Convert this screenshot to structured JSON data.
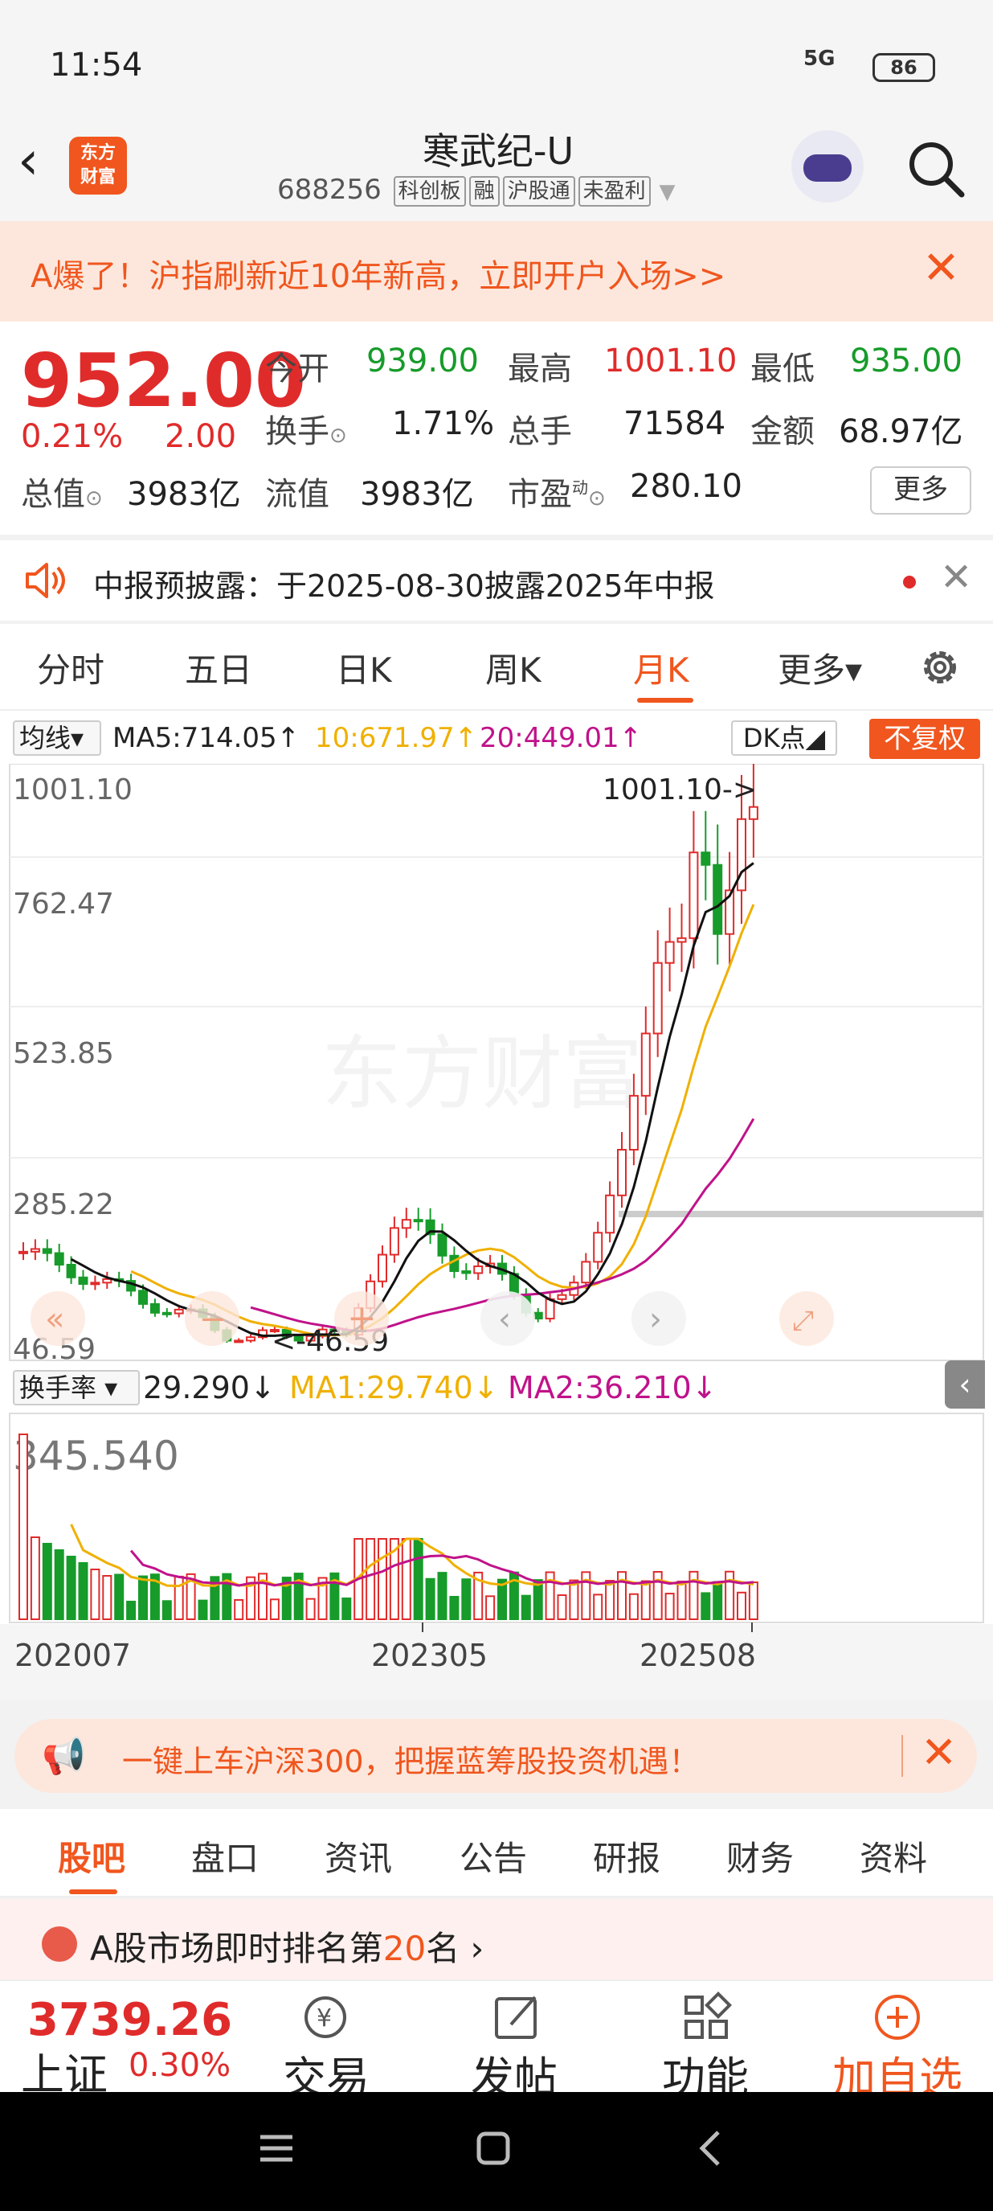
{
  "status": {
    "time": "11:54",
    "signal": "5G",
    "battery": "86"
  },
  "header": {
    "back_icon": "chevron-left-icon",
    "logo_line1": "东方",
    "logo_line2": "财富",
    "stock_name": "寒武纪-U",
    "stock_code": "688256",
    "tags": [
      "科创板",
      "融",
      "沪股通",
      "未盈利"
    ],
    "search_icon": "search-icon"
  },
  "promo": {
    "text": "A爆了！沪指刷新近10年新高，立即开户入场>>"
  },
  "quote": {
    "price": "952.00",
    "change_pct": "0.21%",
    "change_amt": "2.00",
    "open_label": "今开",
    "open": "939.00",
    "high_label": "最高",
    "high": "1001.10",
    "low_label": "最低",
    "low": "935.00",
    "turnover_label": "换手",
    "turnover": "1.71%",
    "volume_label": "总手",
    "volume": "71584",
    "amount_label": "金额",
    "amount": "68.97亿",
    "mktcap_label": "总值",
    "mktcap": "3983亿",
    "float_label": "流值",
    "float": "3983亿",
    "pe_label": "市盈",
    "pe_sup": "动",
    "pe": "280.10",
    "more": "更多"
  },
  "notice": {
    "text": "中报预披露：于2025-08-30披露2025年中报"
  },
  "chart_tabs": [
    "分时",
    "五日",
    "日K",
    "周K",
    "月K",
    "更多▾"
  ],
  "active_chart_tab": "月K",
  "ma_row": {
    "selector": "均线▾",
    "ma5": "MA5:714.05↑",
    "ma10": "10:671.97↑",
    "ma20": "20:449.01↑",
    "dk": "DK点◢",
    "adjust": "不复权"
  },
  "vol_row": {
    "selector": "换手率 ▾",
    "current": "29.290↓",
    "ma1": "MA1:29.740↓",
    "ma2": "MA2:36.210↓",
    "collapse": "‹"
  },
  "chart_data": {
    "type": "candlestick",
    "price_ticks": [
      "1001.10",
      "762.47",
      "523.85",
      "285.22",
      "46.59"
    ],
    "ylim": [
      46.59,
      1001.1
    ],
    "max_label": "1001.10->",
    "min_label": "<-46.59",
    "x_ticks": [
      "202007",
      "202305",
      "202508"
    ],
    "volume_max_label": "345.540",
    "watermark": "东方财富",
    "colors": {
      "up": "#e02b2b",
      "down": "#179b2a",
      "ma5": "#111111",
      "ma10": "#f0b000",
      "ma20": "#c0128a"
    }
  },
  "promo2": {
    "icon": "megaphone-icon",
    "text": "一键上车沪深300，把握蓝筹股投资机遇！"
  },
  "info_tabs": [
    "股吧",
    "盘口",
    "资讯",
    "公告",
    "研报",
    "财务",
    "资料"
  ],
  "active_info_tab": "股吧",
  "rank": {
    "prefix": "A股市场即时排名第",
    "num": "20",
    "suffix": "名 ›"
  },
  "bottom_bar": {
    "index_value": "3739.26",
    "index_name": "上证",
    "index_pct": "0.30%",
    "trade": "交易",
    "post": "发帖",
    "func": "功能",
    "fav": "加自选"
  }
}
